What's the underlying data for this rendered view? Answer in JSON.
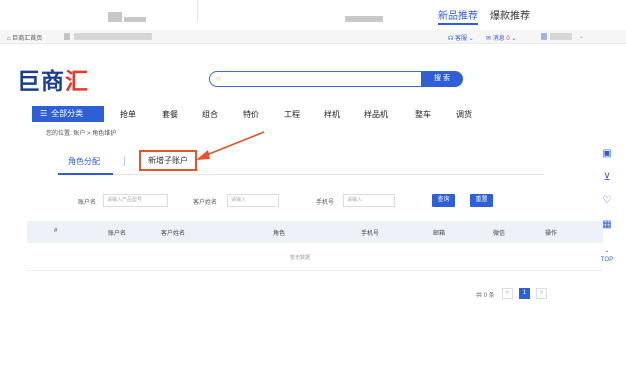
{
  "promo": {
    "tab_new": "新品推荐",
    "tab_hot": "爆款推荐"
  },
  "util": {
    "home": "巨商汇首页",
    "service": "客服",
    "messages": "消息",
    "message_count": "0"
  },
  "logo": {
    "main": "巨商",
    "accent": "汇"
  },
  "search": {
    "placeholder": "",
    "button": "搜 索"
  },
  "nav": {
    "all_label": "全部分类",
    "items": [
      "抢单",
      "套餐",
      "组合",
      "特价",
      "工程",
      "样机",
      "样品机",
      "整车",
      "调货"
    ]
  },
  "breadcrumb": {
    "prefix": "您的位置:",
    "level1": "账户",
    "separator": ">",
    "level2": "角色维护"
  },
  "tabs": {
    "role_assign": "角色分配",
    "add_sub_account": "新增子账户"
  },
  "filters": {
    "account_label": "账户名",
    "account_placeholder": "请输入产品型号",
    "customer_label": "客户姓名",
    "customer_placeholder": "请输入",
    "phone_label": "手机号",
    "phone_placeholder": "请输入",
    "query_button": "查询",
    "reset_button": "重置"
  },
  "table": {
    "headers": [
      "#",
      "账户名",
      "客户姓名",
      "角色",
      "手机号",
      "邮箱",
      "微信",
      "操作"
    ],
    "empty_text": "暂无数据"
  },
  "pager": {
    "total": "共 0 条",
    "prev": "<",
    "current": "1",
    "next": ">"
  },
  "side": {
    "top_label": "TOP"
  },
  "colors": {
    "primary": "#2f5fd7",
    "highlight": "#e8542a",
    "logo": "#1b3f8f",
    "logo_accent": "#e8382f"
  }
}
